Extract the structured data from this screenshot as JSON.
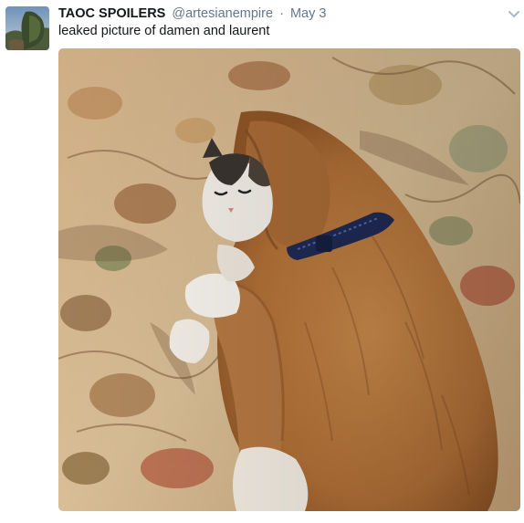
{
  "tweet": {
    "display_name": "TAOC SPOILERS",
    "handle": "@artesianempire",
    "separator": "·",
    "timestamp": "May 3",
    "text": "leaked picture of damen and laurent",
    "media": {
      "subject": "photo-dog-and-cat-cuddling",
      "colors": {
        "blanket": "#d4b489",
        "dog_fur": "#b9773f",
        "collar": "#1f2a55"
      }
    },
    "menu_icon": "chevron-down-icon",
    "avatar_icon": "avatar-image"
  }
}
